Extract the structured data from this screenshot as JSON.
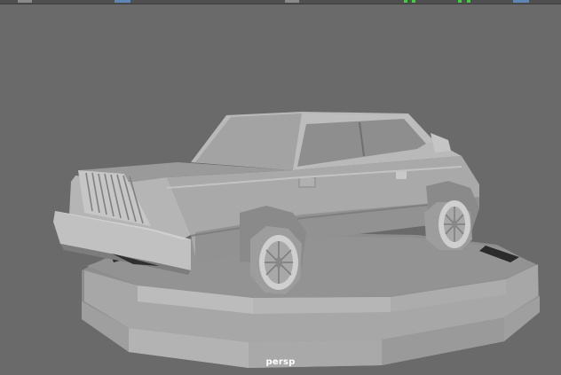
{
  "viewport": {
    "camera_label": "persp"
  },
  "colors": {
    "background": "#6a6a6a",
    "mesh_light": "#bdbdbd",
    "mesh_mid": "#a4a4a4",
    "mesh_dark": "#7c7c7c",
    "accent_blue": "#5d86b3",
    "accent_green": "#3bd13b"
  }
}
